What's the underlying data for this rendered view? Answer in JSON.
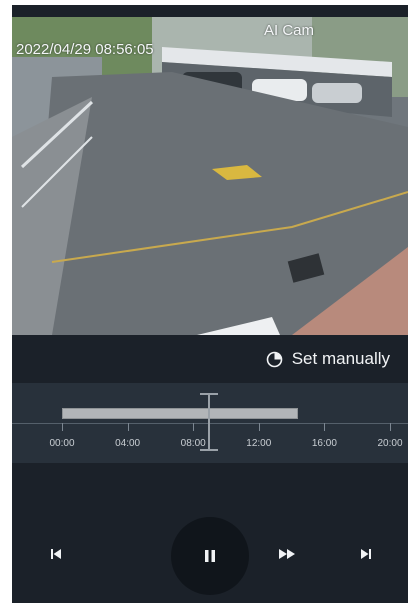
{
  "camera": {
    "timestamp": "2022/04/29 08:56:05",
    "name": "AI Cam"
  },
  "mode": {
    "set_manually_label": "Set manually",
    "icon": "clock-icon"
  },
  "timeline": {
    "start_hour": 0,
    "end_hour": 21.2,
    "tick_labels": [
      "00:00",
      "04:00",
      "08:00",
      "12:00",
      "16:00",
      "20:00"
    ],
    "recording_start_hour": 0,
    "recording_end_hour": 14.4,
    "cursor_hour": 8.9
  },
  "playback": {
    "prev_icon": "skip-previous-icon",
    "pause_icon": "pause-icon",
    "forward_icon": "fast-forward-icon",
    "next_icon": "skip-next-icon"
  },
  "colors": {
    "background": "#1b2129",
    "timeline": "#28313b",
    "recording": "#b2b5b8",
    "text": "#f1f3f5"
  }
}
